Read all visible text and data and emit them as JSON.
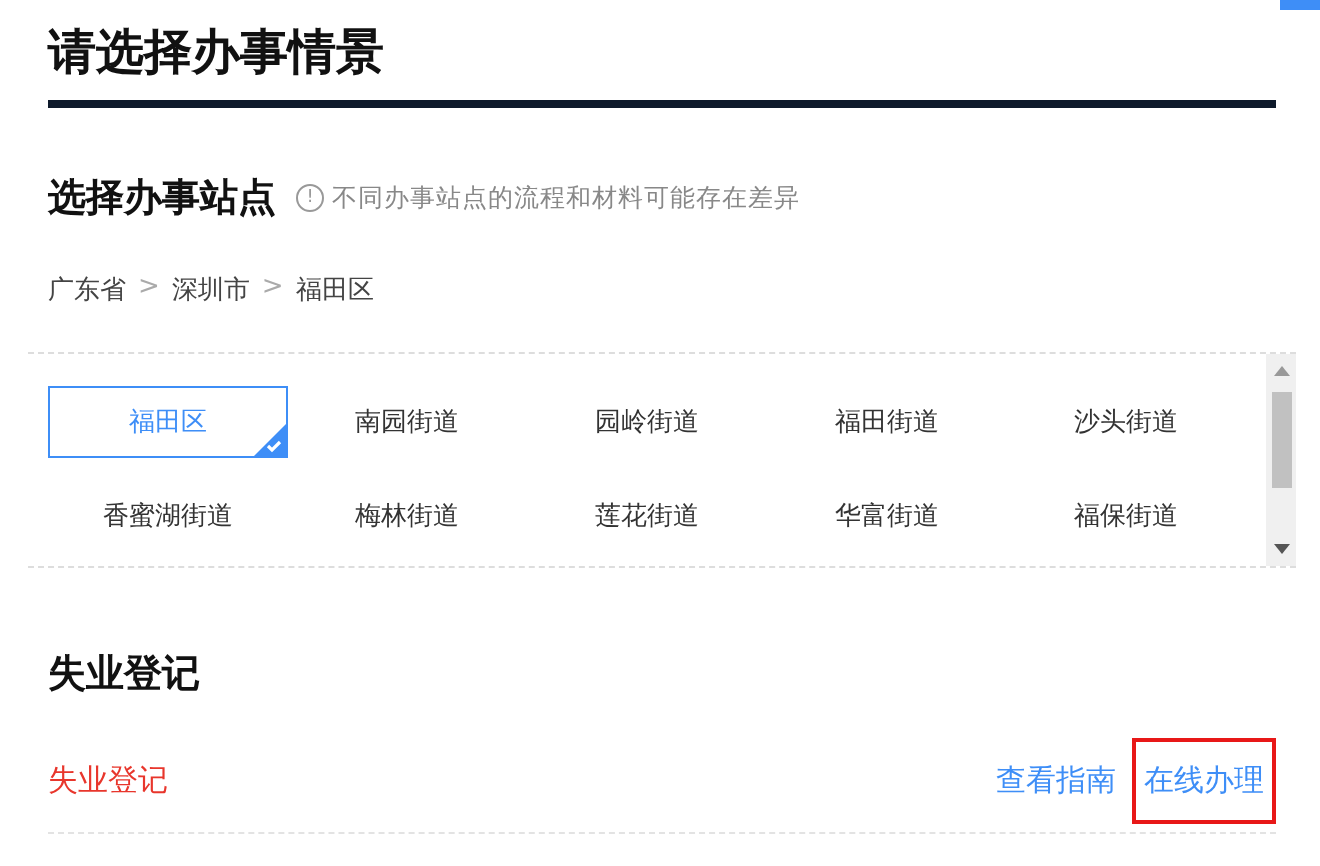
{
  "title": "请选择办事情景",
  "site_section": {
    "heading": "选择办事站点",
    "notice_icon": "!",
    "notice": "不同办事站点的流程和材料可能存在差异",
    "breadcrumb": [
      "广东省",
      "深圳市",
      "福田区"
    ],
    "separator": ">",
    "stations": [
      {
        "label": "福田区",
        "selected": true
      },
      {
        "label": "南园街道",
        "selected": false
      },
      {
        "label": "园岭街道",
        "selected": false
      },
      {
        "label": "福田街道",
        "selected": false
      },
      {
        "label": "沙头街道",
        "selected": false
      },
      {
        "label": "香蜜湖街道",
        "selected": false
      },
      {
        "label": "梅林街道",
        "selected": false
      },
      {
        "label": "莲花街道",
        "selected": false
      },
      {
        "label": "华富街道",
        "selected": false
      },
      {
        "label": "福保街道",
        "selected": false
      }
    ]
  },
  "service_section": {
    "heading": "失业登记",
    "items": [
      {
        "name": "失业登记",
        "actions": [
          {
            "label": "查看指南",
            "highlighted": false
          },
          {
            "label": "在线办理",
            "highlighted": true
          }
        ]
      }
    ]
  }
}
